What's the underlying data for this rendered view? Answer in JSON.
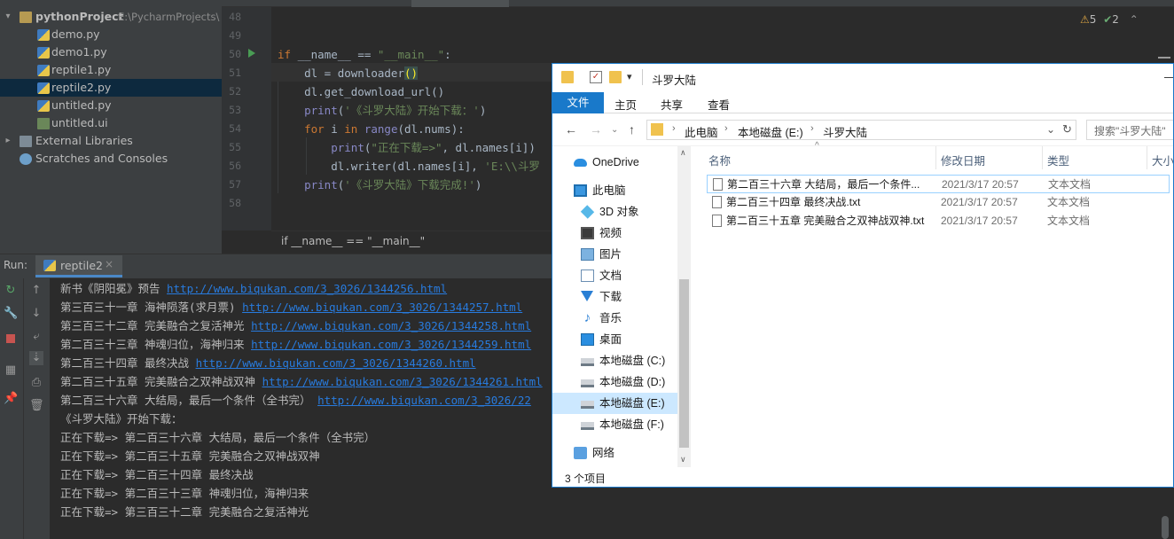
{
  "project_tree": {
    "root_name": "pythonProject",
    "root_path": "E:\\PycharmProjects\\",
    "files": [
      "demo.py",
      "demo1.py",
      "reptile1.py",
      "reptile2.py",
      "untitled.py",
      "untitled.ui"
    ],
    "external_libraries": "External Libraries",
    "scratches": "Scratches and Consoles"
  },
  "editor": {
    "line_numbers": [
      "48",
      "49",
      "50",
      "51",
      "52",
      "53",
      "54",
      "55",
      "56",
      "57",
      "58"
    ],
    "code": {
      "l50_a": "if",
      "l50_b": " __name__ == ",
      "l50_c": "\"__main__\"",
      "l50_d": ":",
      "l51_a": "    dl = downloader",
      "l51_b": "(",
      "l51_c": ")",
      "l52": "    dl.get_download_url()",
      "l53_a": "    print",
      "l53_b": "(",
      "l53_c": "'《斗罗大陆》开始下载：'",
      "l53_d": ")",
      "l54_a": "    ",
      "l54_b": "for",
      "l54_c": " i ",
      "l54_d": "in",
      "l54_e": " ",
      "l54_f": "range",
      "l54_g": "(dl.nums):",
      "l55_a": "        ",
      "l55_b": "print",
      "l55_c": "(",
      "l55_d": "\"正在下载=>\"",
      "l55_e": ", dl.names[i])",
      "l56_a": "        dl.writer(dl.names[i], ",
      "l56_b": "'E:\\\\斗罗",
      "l57_a": "    print",
      "l57_b": "(",
      "l57_c": "'《斗罗大陆》下载完成!'",
      "l57_d": ")"
    },
    "inspection": {
      "warnings": "5",
      "ok": "2"
    },
    "breadcrumb": "if __name__ == \"__main__\""
  },
  "run_panel": {
    "label": "Run:",
    "tab_name": "reptile2",
    "tab_close": "×",
    "output": [
      {
        "text": "新书《阴阳冕》预告 ",
        "link": "http://www.biqukan.com/3_3026/1344256.html"
      },
      {
        "text": "第三百三十一章 海神陨落(求月票) ",
        "link": "http://www.biqukan.com/3_3026/1344257.html"
      },
      {
        "text": "第三百三十二章 完美融合之复活神光 ",
        "link": "http://www.biqukan.com/3_3026/1344258.html"
      },
      {
        "text": "第二百三十三章 神魂归位，海神归来 ",
        "link": "http://www.biqukan.com/3_3026/1344259.html"
      },
      {
        "text": "第二百三十四章 最终决战 ",
        "link": "http://www.biqukan.com/3_3026/1344260.html"
      },
      {
        "text": "第二百三十五章 完美融合之双神战双神 ",
        "link": "http://www.biqukan.com/3_3026/1344261.html"
      },
      {
        "text": "第二百三十六章 大结局，最后一个条件（全书完） ",
        "link": "http://www.biqukan.com/3_3026/22"
      },
      {
        "text": "《斗罗大陆》开始下载：",
        "link": ""
      },
      {
        "text": "正在下载=> 第二百三十六章 大结局，最后一个条件（全书完）",
        "link": ""
      },
      {
        "text": "正在下载=> 第二百三十五章 完美融合之双神战双神",
        "link": ""
      },
      {
        "text": "正在下载=> 第二百三十四章 最终决战",
        "link": ""
      },
      {
        "text": "正在下载=> 第二百三十三章 神魂归位，海神归来",
        "link": ""
      },
      {
        "text": "正在下载=> 第三百三十二章 完美融合之复活神光",
        "link": ""
      }
    ]
  },
  "explorer": {
    "title": "斗罗大陆",
    "minimize": "—",
    "ribbon": {
      "file": "文件",
      "home": "主页",
      "share": "共享",
      "view": "查看"
    },
    "address": {
      "pc": "此电脑",
      "drive": "本地磁盘 (E:)",
      "folder": "斗罗大陆",
      "sep": "›",
      "dropdown": "⌄",
      "refresh": "↻"
    },
    "search_placeholder": "搜索\"斗罗大陆\"",
    "nav": {
      "onedrive": "OneDrive",
      "this_pc": "此电脑",
      "objects3d": "3D 对象",
      "videos": "视频",
      "pictures": "图片",
      "documents": "文档",
      "downloads": "下载",
      "music": "音乐",
      "desktop": "桌面",
      "drive_c": "本地磁盘 (C:)",
      "drive_d": "本地磁盘 (D:)",
      "drive_e": "本地磁盘 (E:)",
      "drive_f": "本地磁盘 (F:)",
      "network": "网络"
    },
    "columns": {
      "name": "名称",
      "date": "修改日期",
      "type": "类型",
      "size": "大小"
    },
    "files": [
      {
        "name": "第二百三十六章 大结局，最后一个条件...",
        "date": "2021/3/17 20:57",
        "type": "文本文档"
      },
      {
        "name": "第二百三十四章 最终决战.txt",
        "date": "2021/3/17 20:57",
        "type": "文本文档"
      },
      {
        "name": "第二百三十五章 完美融合之双神战双神.txt",
        "date": "2021/3/17 20:57",
        "type": "文本文档"
      }
    ],
    "status": "3 个项目"
  },
  "colors": {
    "accent": "#1979ca",
    "link": "#287bde",
    "selection": "#0d293e"
  }
}
